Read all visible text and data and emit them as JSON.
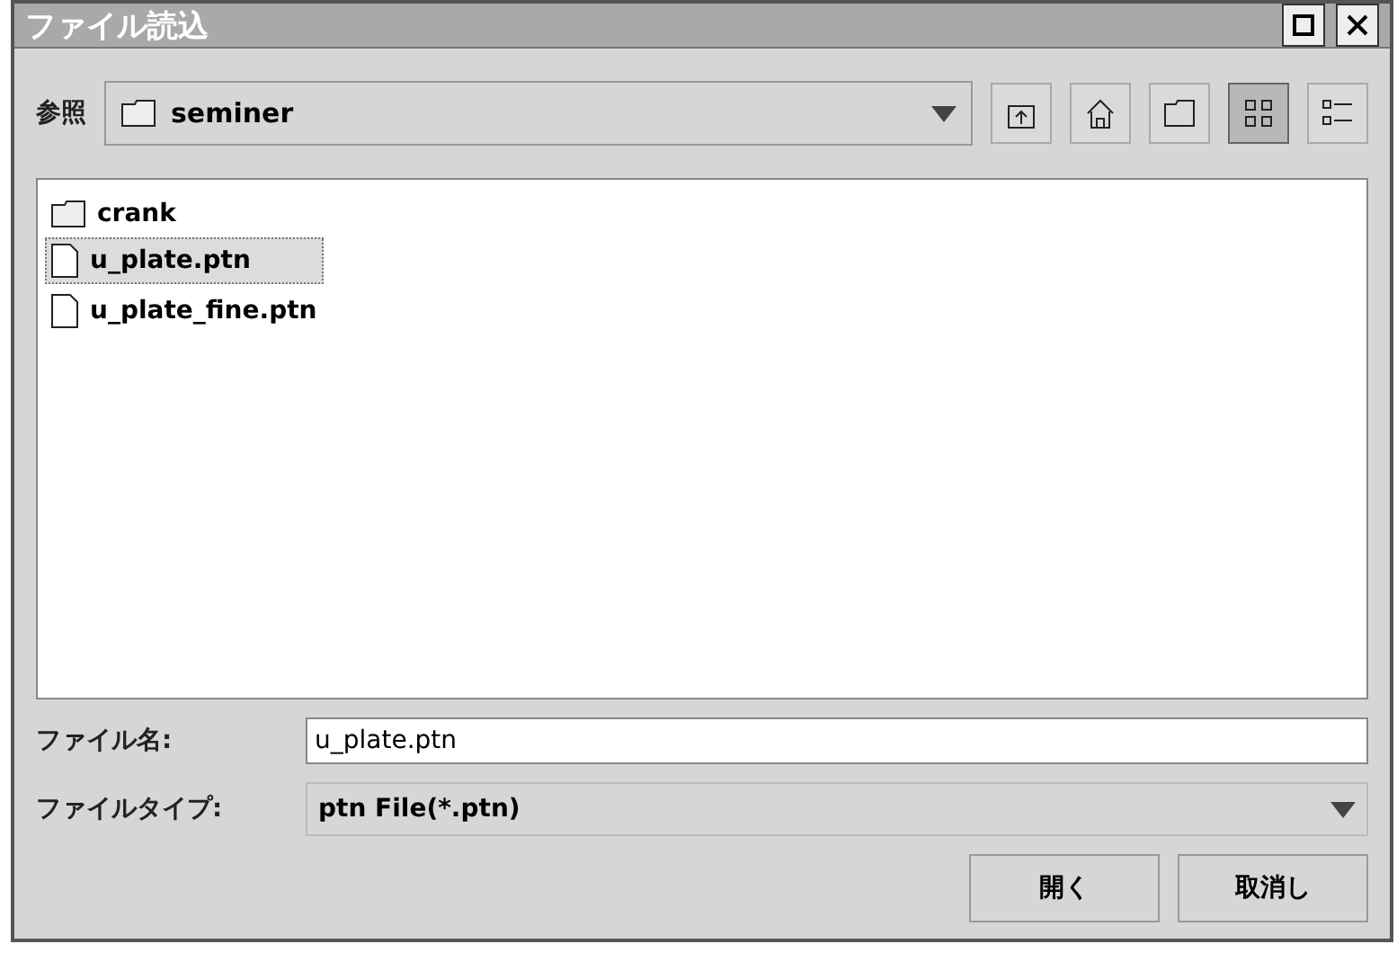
{
  "window": {
    "title": "ファイル読込"
  },
  "look_in": {
    "label": "参照",
    "value": "seminer"
  },
  "files": [
    {
      "name": "crank",
      "kind": "folder",
      "selected": false
    },
    {
      "name": "u_plate.ptn",
      "kind": "file",
      "selected": true
    },
    {
      "name": "u_plate_fine.ptn",
      "kind": "file",
      "selected": false
    }
  ],
  "file_name": {
    "label": "ファイル名:",
    "value": "u_plate.ptn"
  },
  "file_type": {
    "label": "ファイルタイプ:",
    "value": "ptn File(*.ptn)"
  },
  "view_modes": [
    {
      "kind": "list",
      "selected": true
    },
    {
      "kind": "details",
      "selected": false
    }
  ],
  "buttons": [
    "開く",
    "取消し"
  ]
}
